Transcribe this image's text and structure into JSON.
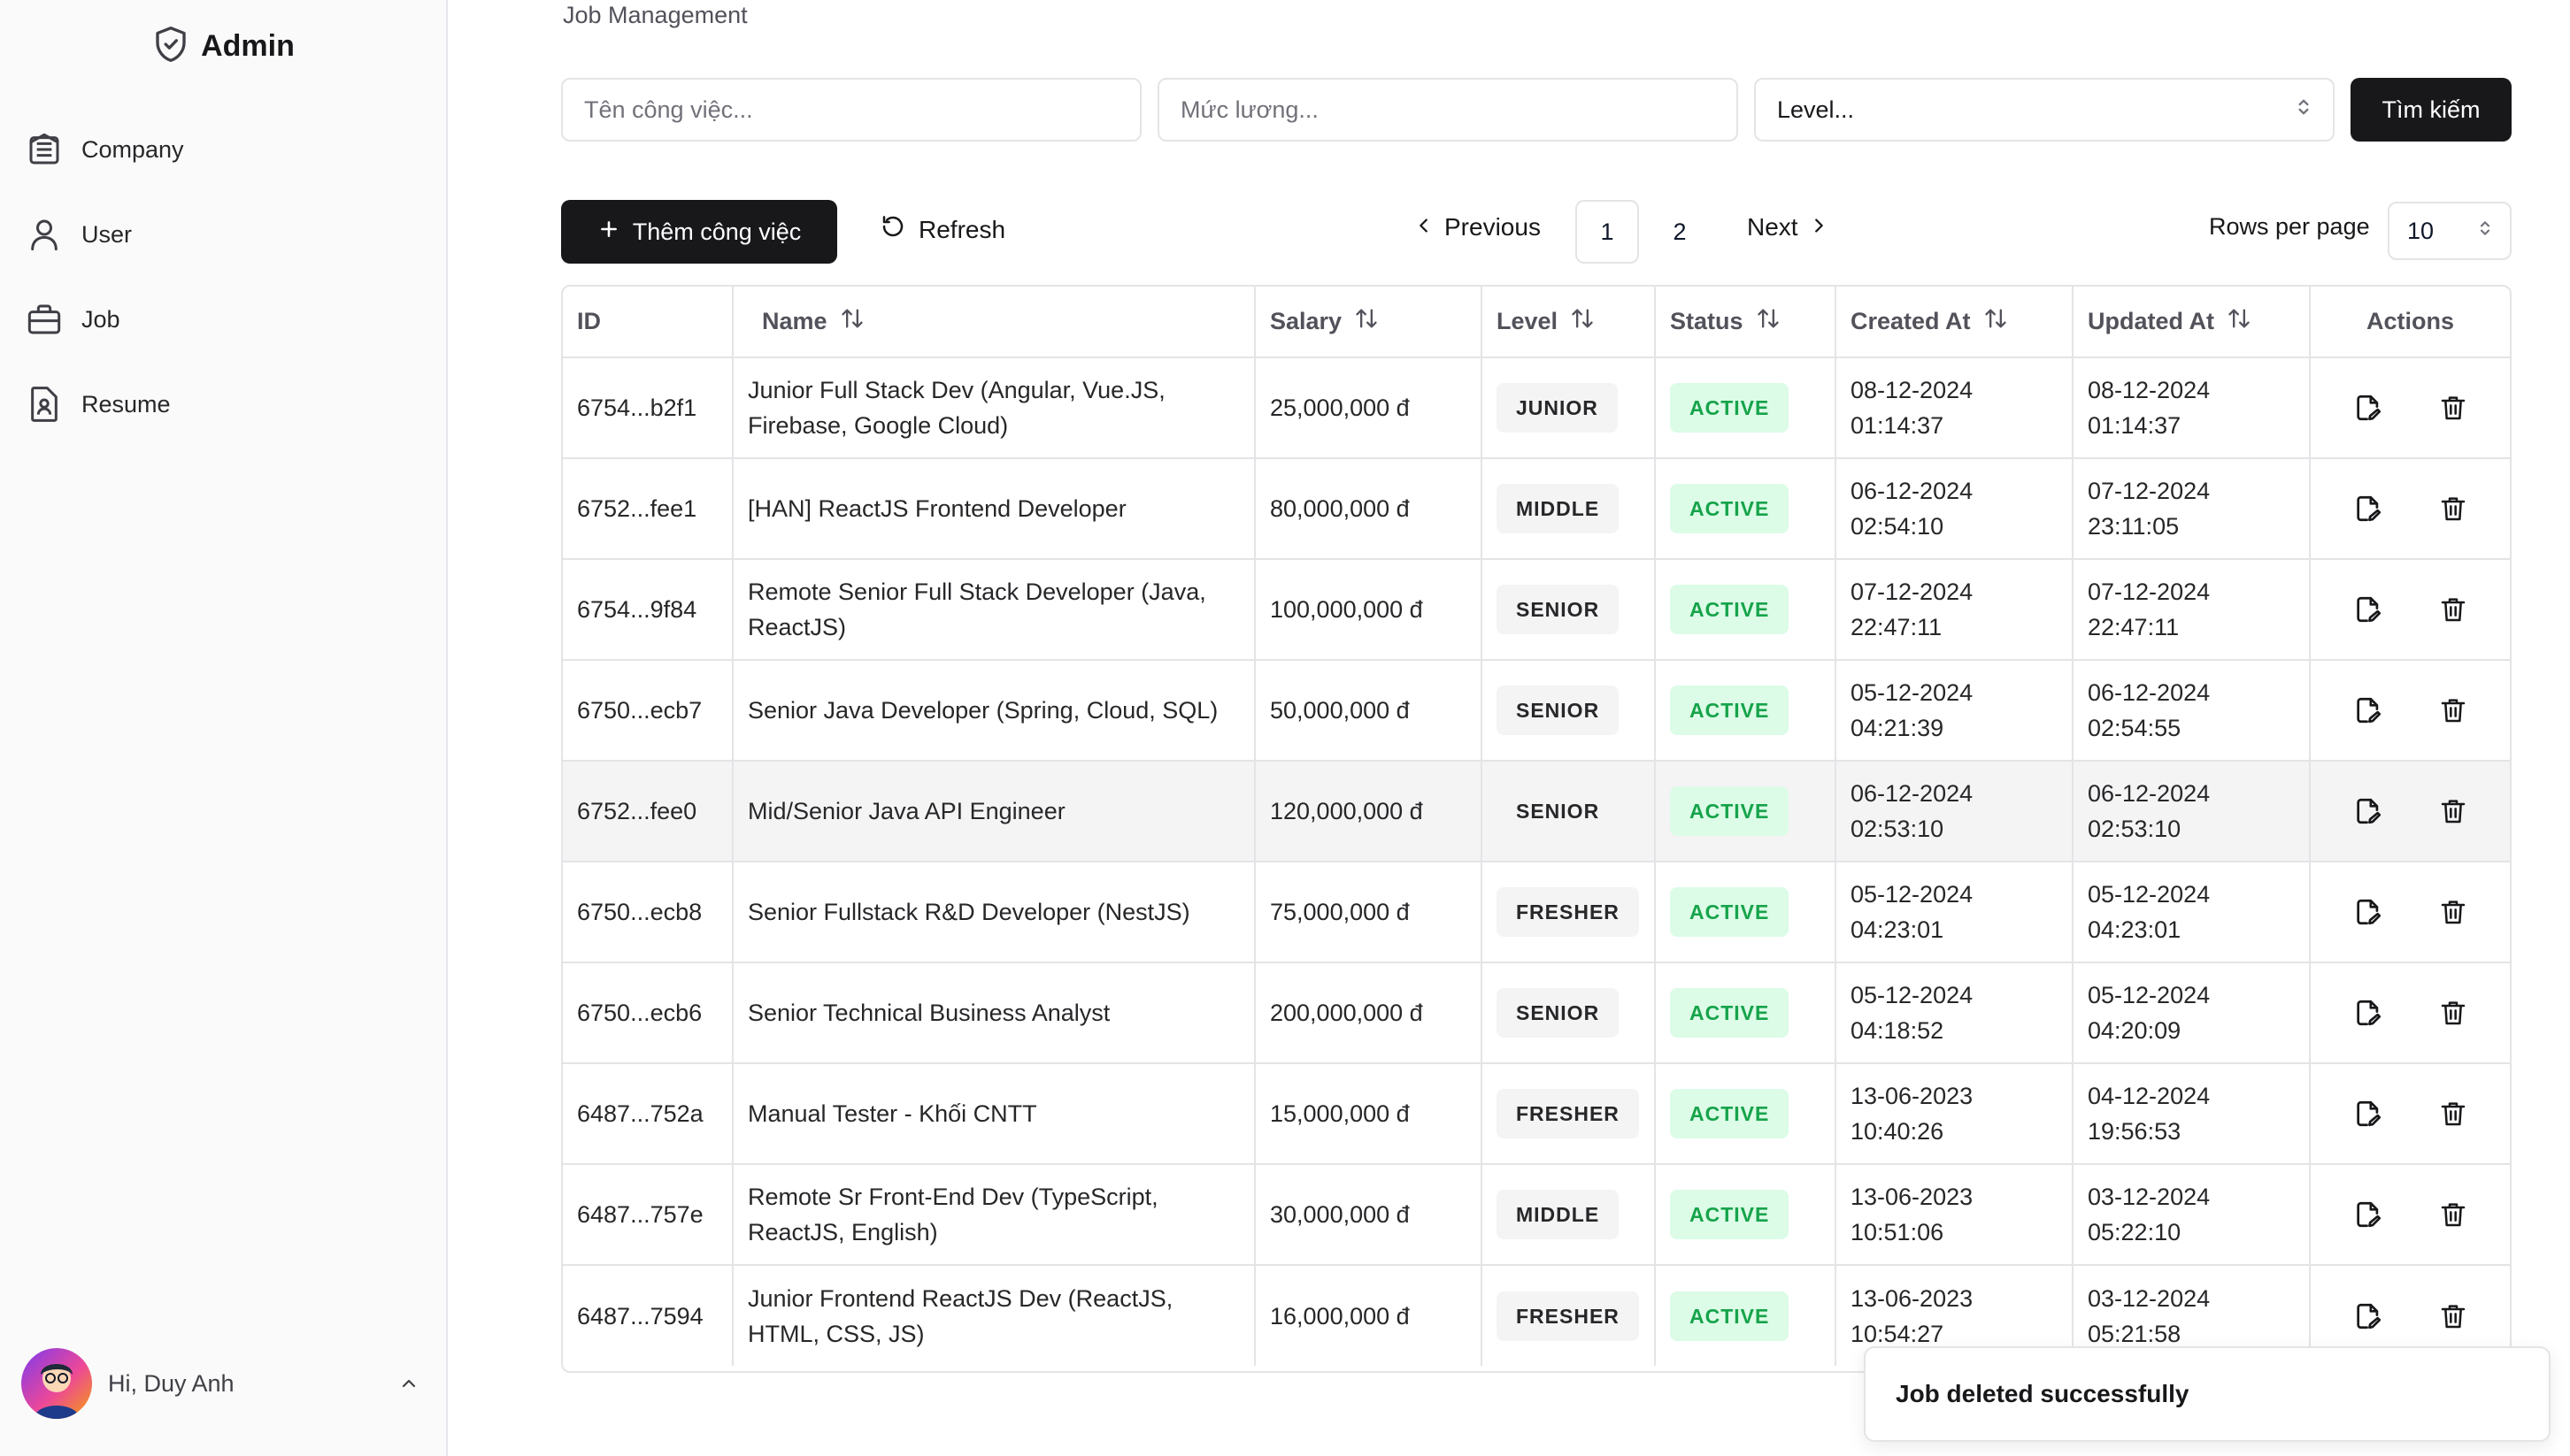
{
  "sidebar": {
    "brand": "Admin",
    "items": [
      {
        "label": "Company",
        "icon": "building-icon"
      },
      {
        "label": "User",
        "icon": "user-icon"
      },
      {
        "label": "Job",
        "icon": "briefcase-icon"
      },
      {
        "label": "Resume",
        "icon": "resume-icon"
      }
    ],
    "user_greeting": "Hi, Duy Anh"
  },
  "main": {
    "breadcrumb": "Job Management",
    "search": {
      "name_placeholder": "Tên công việc...",
      "salary_placeholder": "Mức lương...",
      "level_value": "Level...",
      "submit_label": "Tìm kiếm"
    },
    "toolbar": {
      "add_label": "Thêm công việc",
      "refresh_label": "Refresh"
    },
    "pagination": {
      "prev_label": "Previous",
      "next_label": "Next",
      "pages": [
        "1",
        "2"
      ],
      "current": "1",
      "rows_label": "Rows per page",
      "rows_value": "10"
    },
    "table": {
      "columns": [
        "ID",
        "Name",
        "Salary",
        "Level",
        "Status",
        "Created At",
        "Updated At",
        "Actions"
      ],
      "rows": [
        {
          "id": "6754...b2f1",
          "name": "Junior Full Stack Dev (Angular, Vue.JS, Firebase, Google Cloud)",
          "salary": "25,000,000 đ",
          "level": "JUNIOR",
          "status": "ACTIVE",
          "created_date": "08-12-2024",
          "created_time": "01:14:37",
          "updated_date": "08-12-2024",
          "updated_time": "01:14:37"
        },
        {
          "id": "6752...fee1",
          "name": "[HAN] ReactJS Frontend Developer",
          "salary": "80,000,000 đ",
          "level": "MIDDLE",
          "status": "ACTIVE",
          "created_date": "06-12-2024",
          "created_time": "02:54:10",
          "updated_date": "07-12-2024",
          "updated_time": "23:11:05"
        },
        {
          "id": "6754...9f84",
          "name": "Remote Senior Full Stack Developer (Java, ReactJS)",
          "salary": "100,000,000 đ",
          "level": "SENIOR",
          "status": "ACTIVE",
          "created_date": "07-12-2024",
          "created_time": "22:47:11",
          "updated_date": "07-12-2024",
          "updated_time": "22:47:11"
        },
        {
          "id": "6750...ecb7",
          "name": "Senior Java Developer (Spring, Cloud, SQL)",
          "salary": "50,000,000 đ",
          "level": "SENIOR",
          "status": "ACTIVE",
          "created_date": "05-12-2024",
          "created_time": "04:21:39",
          "updated_date": "06-12-2024",
          "updated_time": "02:54:55"
        },
        {
          "id": "6752...fee0",
          "name": "Mid/Senior Java API Engineer",
          "salary": "120,000,000 đ",
          "level": "SENIOR",
          "status": "ACTIVE",
          "created_date": "06-12-2024",
          "created_time": "02:53:10",
          "updated_date": "06-12-2024",
          "updated_time": "02:53:10"
        },
        {
          "id": "6750...ecb8",
          "name": "Senior Fullstack R&D Developer (NestJS)",
          "salary": "75,000,000 đ",
          "level": "FRESHER",
          "status": "ACTIVE",
          "created_date": "05-12-2024",
          "created_time": "04:23:01",
          "updated_date": "05-12-2024",
          "updated_time": "04:23:01"
        },
        {
          "id": "6750...ecb6",
          "name": "Senior Technical Business Analyst",
          "salary": "200,000,000 đ",
          "level": "SENIOR",
          "status": "ACTIVE",
          "created_date": "05-12-2024",
          "created_time": "04:18:52",
          "updated_date": "05-12-2024",
          "updated_time": "04:20:09"
        },
        {
          "id": "6487...752a",
          "name": "Manual Tester - Khối CNTT",
          "salary": "15,000,000 đ",
          "level": "FRESHER",
          "status": "ACTIVE",
          "created_date": "13-06-2023",
          "created_time": "10:40:26",
          "updated_date": "04-12-2024",
          "updated_time": "19:56:53"
        },
        {
          "id": "6487...757e",
          "name": "Remote Sr Front-End Dev (TypeScript, ReactJS, English)",
          "salary": "30,000,000 đ",
          "level": "MIDDLE",
          "status": "ACTIVE",
          "created_date": "13-06-2023",
          "created_time": "10:51:06",
          "updated_date": "03-12-2024",
          "updated_time": "05:22:10"
        },
        {
          "id": "6487...7594",
          "name": "Junior Frontend ReactJS Dev (ReactJS, HTML, CSS, JS)",
          "salary": "16,000,000 đ",
          "level": "FRESHER",
          "status": "ACTIVE",
          "created_date": "13-06-2023",
          "created_time": "10:54:27",
          "updated_date": "03-12-2024",
          "updated_time": "05:21:58"
        }
      ]
    }
  },
  "toast": {
    "message": "Job deleted successfully"
  },
  "colors": {
    "primary": "#18181b",
    "active_bg": "#dcfce7",
    "active_text": "#16a34a",
    "border": "#e4e4e7",
    "sidebar_bg": "#fafafa"
  }
}
